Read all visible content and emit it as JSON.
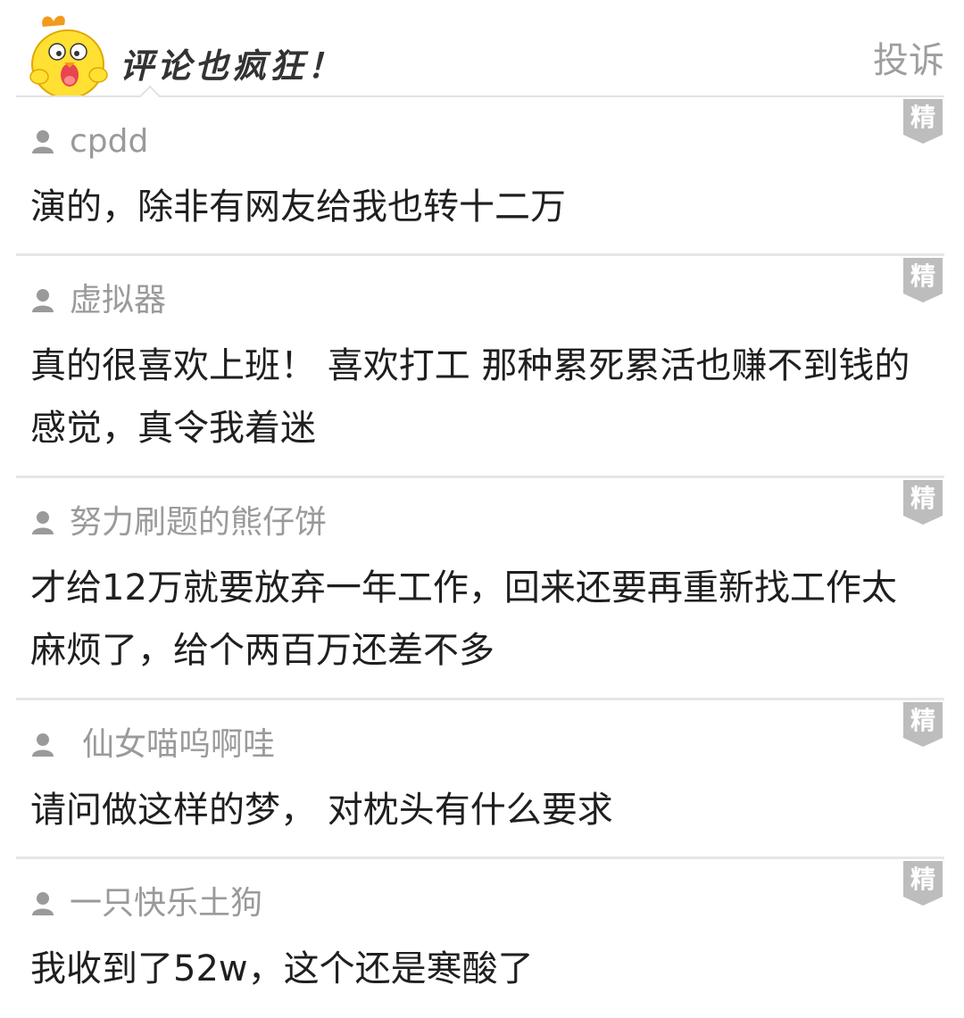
{
  "header": {
    "title": "评论也疯狂！",
    "report_label": "投诉",
    "mascot_icon": "yellow-chick-mascot"
  },
  "comments": [
    {
      "username": "cpdd",
      "text": "演的，除非有网友给我也转十二万",
      "badge": "精"
    },
    {
      "username": "虚拟器",
      "text": "真的很喜欢上班！  喜欢打工 那种累死累活也赚不到钱的感觉，真令我着迷",
      "badge": "精"
    },
    {
      "username": "努力刷题的熊仔饼",
      "text": "才给12万就要放弃一年工作，回来还要再重新找工作太麻烦了，给个两百万还差不多",
      "badge": "精"
    },
    {
      "username": "仙女喵呜啊哇",
      "text": "请问做这样的梦，  对枕头有什么要求",
      "badge": "精"
    },
    {
      "username": "一只快乐土狗",
      "text": "我收到了52w，这个还是寒酸了",
      "badge": "精"
    }
  ],
  "colors": {
    "badge_bg": "#bdbdbd",
    "username": "#9a9a9a",
    "text": "#1f1f1f",
    "divider": "#e6e6e6",
    "mascot_yellow": "#ffe033",
    "mascot_orange": "#f39a1b"
  }
}
